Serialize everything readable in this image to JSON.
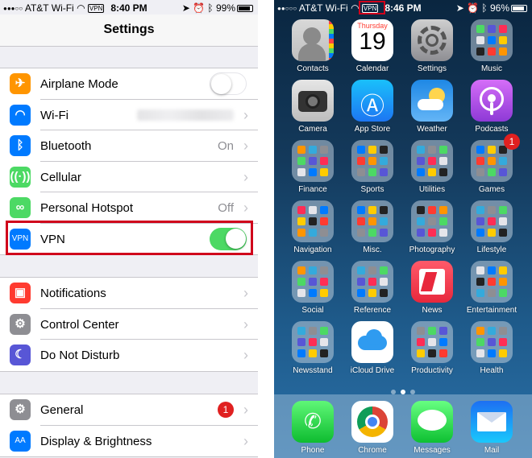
{
  "settings_screen": {
    "status_bar": {
      "carrier": "AT&T Wi-Fi",
      "time": "8:40 PM",
      "battery": "99%",
      "vpn_indicator": "VPN"
    },
    "title": "Settings",
    "group1": [
      {
        "label": "Airplane Mode",
        "icon": "airplane-icon",
        "color": "#ff9500",
        "toggle": "off"
      },
      {
        "label": "Wi-Fi",
        "icon": "wifi-icon",
        "color": "#007aff"
      },
      {
        "label": "Bluetooth",
        "icon": "bluetooth-icon",
        "color": "#007aff",
        "value": "On"
      },
      {
        "label": "Cellular",
        "icon": "cellular-icon",
        "color": "#4cd964"
      },
      {
        "label": "Personal Hotspot",
        "icon": "hotspot-icon",
        "color": "#4cd964",
        "value": "Off"
      },
      {
        "label": "VPN",
        "icon": "vpn-icon",
        "icon_text": "VPN",
        "color": "#007aff",
        "toggle": "on"
      }
    ],
    "group2": [
      {
        "label": "Notifications",
        "icon": "notifications-icon",
        "color": "#ff3b30"
      },
      {
        "label": "Control Center",
        "icon": "control-center-icon",
        "color": "#8e8e93"
      },
      {
        "label": "Do Not Disturb",
        "icon": "moon-icon",
        "color": "#5856d6"
      }
    ],
    "group3": [
      {
        "label": "General",
        "icon": "gear-icon",
        "color": "#8e8e93",
        "badge": "1"
      },
      {
        "label": "Display & Brightness",
        "icon": "display-icon",
        "icon_text": "AA",
        "color": "#007aff"
      }
    ]
  },
  "home_screen": {
    "status_bar": {
      "carrier": "AT&T Wi-Fi",
      "time": "8:46 PM",
      "battery": "96%",
      "vpn_indicator": "VPN"
    },
    "calendar": {
      "weekday": "Thursday",
      "day": "19"
    },
    "apps": [
      {
        "label": "Contacts",
        "icon": "contacts-icon",
        "kind": "contacts"
      },
      {
        "label": "Calendar",
        "icon": "calendar-icon",
        "kind": "calendar"
      },
      {
        "label": "Settings",
        "icon": "settings-gear-icon",
        "kind": "settings"
      },
      {
        "label": "Music",
        "icon": "music-folder-icon",
        "kind": "folder"
      },
      {
        "label": "Camera",
        "icon": "camera-icon",
        "kind": "camera"
      },
      {
        "label": "App Store",
        "icon": "app-store-icon",
        "kind": "appstore"
      },
      {
        "label": "Weather",
        "icon": "weather-icon",
        "kind": "weather"
      },
      {
        "label": "Podcasts",
        "icon": "podcasts-icon",
        "kind": "podcasts"
      },
      {
        "label": "Finance",
        "icon": "finance-folder-icon",
        "kind": "folder"
      },
      {
        "label": "Sports",
        "icon": "sports-folder-icon",
        "kind": "folder"
      },
      {
        "label": "Utilities",
        "icon": "utilities-folder-icon",
        "kind": "folder"
      },
      {
        "label": "Games",
        "icon": "games-folder-icon",
        "kind": "folder",
        "badge": "1"
      },
      {
        "label": "Navigation",
        "icon": "navigation-folder-icon",
        "kind": "folder"
      },
      {
        "label": "Misc.",
        "icon": "misc-folder-icon",
        "kind": "folder"
      },
      {
        "label": "Photography",
        "icon": "photography-folder-icon",
        "kind": "folder"
      },
      {
        "label": "Lifestyle",
        "icon": "lifestyle-folder-icon",
        "kind": "folder"
      },
      {
        "label": "Social",
        "icon": "social-folder-icon",
        "kind": "folder"
      },
      {
        "label": "Reference",
        "icon": "reference-folder-icon",
        "kind": "folder"
      },
      {
        "label": "News",
        "icon": "news-icon",
        "kind": "news"
      },
      {
        "label": "Entertainment",
        "icon": "entertainment-folder-icon",
        "kind": "folder"
      },
      {
        "label": "Newsstand",
        "icon": "newsstand-folder-icon",
        "kind": "folder"
      },
      {
        "label": "iCloud Drive",
        "icon": "icloud-drive-icon",
        "kind": "icloud"
      },
      {
        "label": "Productivity",
        "icon": "productivity-folder-icon",
        "kind": "folder"
      },
      {
        "label": "Health",
        "icon": "health-folder-icon",
        "kind": "folder"
      }
    ],
    "dock": [
      {
        "label": "Phone",
        "icon": "phone-icon",
        "kind": "phone"
      },
      {
        "label": "Chrome",
        "icon": "chrome-icon",
        "kind": "chrome"
      },
      {
        "label": "Messages",
        "icon": "messages-icon",
        "kind": "messages"
      },
      {
        "label": "Mail",
        "icon": "mail-icon",
        "kind": "mail"
      }
    ]
  }
}
